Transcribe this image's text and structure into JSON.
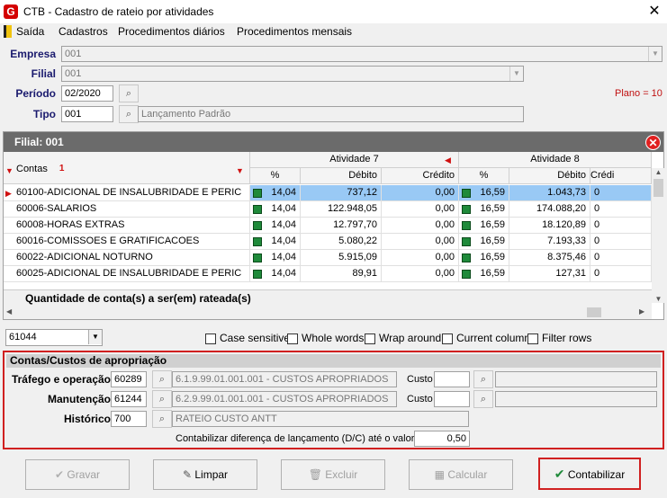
{
  "window": {
    "title": "CTB - Cadastro de rateio por atividades",
    "close": "✕",
    "logo": "G"
  },
  "menu": [
    "Saída",
    "Cadastros",
    "Procedimentos diários",
    "Procedimentos mensais"
  ],
  "form": {
    "empresa_label": "Empresa",
    "empresa_value": "001",
    "filial_label": "Filial",
    "filial_value": "001",
    "periodo_label": "Período",
    "periodo_value": "02/2020",
    "tipo_label": "Tipo",
    "tipo_value": "001",
    "tipo_desc": "Lançamento Padrão",
    "plano": "Plano = 10"
  },
  "grid": {
    "header": "Filial: 001",
    "contas_label": "Contas",
    "sort_index": "1",
    "atividade_7": "Atividade 7",
    "atividade_8": "Atividade 8",
    "cols": [
      "%",
      "Débito",
      "Crédito",
      "%",
      "Débito",
      "Crédi"
    ],
    "rows": [
      {
        "conta": "60100-ADICIONAL DE INSALUBRIDADE E PERIC",
        "p7": "14,04",
        "d7": "737,12",
        "c7": "0,00",
        "p8": "16,59",
        "d8": "1.043,73",
        "c8": "0"
      },
      {
        "conta": "60006-SALARIOS",
        "p7": "14,04",
        "d7": "122.948,05",
        "c7": "0,00",
        "p8": "16,59",
        "d8": "174.088,20",
        "c8": "0"
      },
      {
        "conta": "60008-HORAS EXTRAS",
        "p7": "14,04",
        "d7": "12.797,70",
        "c7": "0,00",
        "p8": "16,59",
        "d8": "18.120,89",
        "c8": "0"
      },
      {
        "conta": "60016-COMISSOES E GRATIFICACOES",
        "p7": "14,04",
        "d7": "5.080,22",
        "c7": "0,00",
        "p8": "16,59",
        "d8": "7.193,33",
        "c8": "0"
      },
      {
        "conta": "60022-ADICIONAL NOTURNO",
        "p7": "14,04",
        "d7": "5.915,09",
        "c7": "0,00",
        "p8": "16,59",
        "d8": "8.375,46",
        "c8": "0"
      },
      {
        "conta": "60025-ADICIONAL DE INSALUBRIDADE E PERIC",
        "p7": "14,04",
        "d7": "89,91",
        "c7": "0,00",
        "p8": "16,59",
        "d8": "127,31",
        "c8": "0"
      }
    ],
    "footer": "Quantidade de conta(s) a ser(em) rateada(s)"
  },
  "search": {
    "value": "61044",
    "options": [
      "Case sensitive",
      "Whole words",
      "Wrap around",
      "Current column",
      "Filter rows"
    ]
  },
  "custos": {
    "title": "Contas/Custos de apropriação",
    "trafego_label": "Tráfego e operação",
    "trafego_code": "60289",
    "trafego_desc": "6.1.9.99.01.001.001 - CUSTOS APROPRIADOS",
    "manut_label": "Manutenção",
    "manut_code": "61244",
    "manut_desc": "6.2.9.99.01.001.001 - CUSTOS APROPRIADOS",
    "hist_label": "Histórico",
    "hist_code": "700",
    "hist_desc": "RATEIO CUSTO ANTT",
    "custo_label": "Custo",
    "dif_label": "Contabilizar diferença de lançamento (D/C) até o valor:",
    "dif_value": "0,50"
  },
  "buttons": {
    "gravar": "Gravar",
    "limpar": "Limpar",
    "excluir": "Excluir",
    "calcular": "Calcular",
    "contabilizar": "Contabilizar"
  },
  "colors": {
    "accent_red": "#d02020",
    "selection": "#99c9f5",
    "header_gray": "#6b6b6b",
    "label_navy": "#1a1a6e",
    "check_green": "#1f8a3a"
  }
}
